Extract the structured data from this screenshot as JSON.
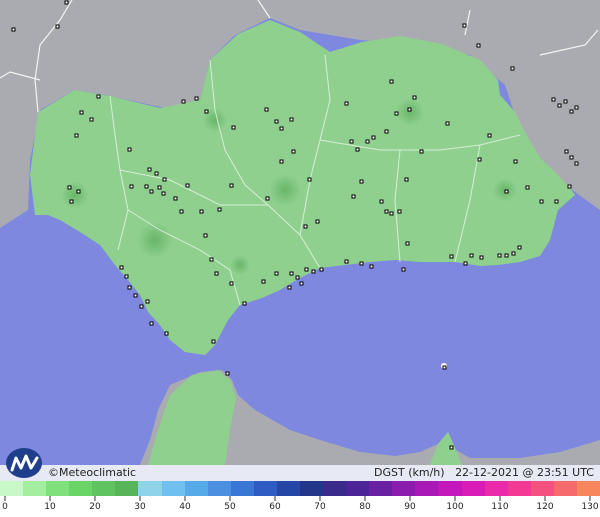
{
  "credit": "©Meteoclimatic",
  "variable": "DGST (km/h)",
  "timestamp": "22-12-2021 @ 23:51 UTC",
  "logo_icon": "meteoclimatic-logo-icon",
  "colors": {
    "sea": "#7f88df",
    "land_other": "#a9abb0",
    "land_data": "#8fd08f",
    "border": "#eeeeee",
    "station": "#000000"
  },
  "legend": {
    "ticks": [
      "0",
      "10",
      "20",
      "30",
      "40",
      "50",
      "60",
      "70",
      "80",
      "90",
      "100",
      "110",
      "120",
      "130"
    ],
    "colors": [
      "#c8f7c8",
      "#a3ee9f",
      "#7fe07c",
      "#6ad466",
      "#5fc45f",
      "#58b458",
      "#8ed3e8",
      "#6fc0ee",
      "#57aae8",
      "#4b8fe0",
      "#3a76d4",
      "#2e5cc2",
      "#2646a6",
      "#23368a",
      "#3a2a8c",
      "#4b2597",
      "#6a20a3",
      "#8a1cae",
      "#a819b8",
      "#c418bd",
      "#d91cb8",
      "#ea2aa8",
      "#f23a94",
      "#f5517f",
      "#f76a6c",
      "#f8865c"
    ]
  }
}
